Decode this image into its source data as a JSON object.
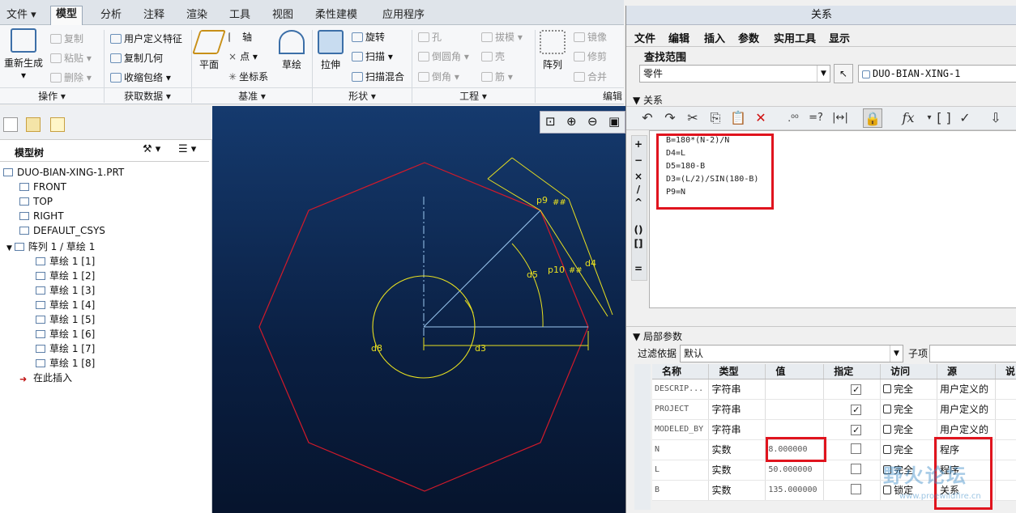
{
  "ribbon": {
    "file_tab": "文件",
    "tabs": [
      "模型",
      "分析",
      "注释",
      "渲染",
      "工具",
      "视图",
      "柔性建模",
      "应用程序"
    ],
    "regenerate": "重新生成",
    "copy": "复制",
    "paste": "粘贴",
    "delete": "删除",
    "udf": "用户定义特征",
    "copy_geom": "复制几何",
    "shrinkwrap": "收缩包络",
    "plane": "平面",
    "axis": "轴",
    "point": "点",
    "csys": "坐标系",
    "sketch": "草绘",
    "extrude": "拉伸",
    "revolve": "旋转",
    "sweep": "扫描",
    "swept_blend": "扫描混合",
    "hole": "孔",
    "round": "倒圆角",
    "chamfer": "倒角",
    "draft": "拔模",
    "shell": "壳",
    "rib": "筋",
    "pattern": "阵列",
    "mirror": "镜像",
    "trim": "修剪",
    "merge": "合并",
    "groups": [
      "操作",
      "获取数据",
      "基准",
      "形状",
      "工程",
      "编辑"
    ]
  },
  "left_panel": {
    "title": "模型树",
    "items": [
      {
        "label": "DUO-BIAN-XING-1.PRT",
        "level": 0
      },
      {
        "label": "FRONT",
        "level": 1
      },
      {
        "label": "TOP",
        "level": 1
      },
      {
        "label": "RIGHT",
        "level": 1
      },
      {
        "label": "DEFAULT_CSYS",
        "level": 1
      },
      {
        "label": "阵列 1 / 草绘 1",
        "level": 1
      },
      {
        "label": "草绘 1 [1]",
        "level": 2
      },
      {
        "label": "草绘 1 [2]",
        "level": 2
      },
      {
        "label": "草绘 1 [3]",
        "level": 2
      },
      {
        "label": "草绘 1 [4]",
        "level": 2
      },
      {
        "label": "草绘 1 [5]",
        "level": 2
      },
      {
        "label": "草绘 1 [6]",
        "level": 2
      },
      {
        "label": "草绘 1 [7]",
        "level": 2
      },
      {
        "label": "草绘 1 [8]",
        "level": 2
      },
      {
        "label": "在此插入",
        "level": 1
      }
    ]
  },
  "canvas": {
    "labels": {
      "p9": "p9",
      "p10": "p10",
      "d4": "d4",
      "d5": "d5",
      "d3": "d3",
      "d8": "d8",
      "hash": "##"
    }
  },
  "dialog": {
    "title": "关系",
    "menu": [
      "文件",
      "编辑",
      "插入",
      "参数",
      "实用工具",
      "显示"
    ],
    "scope_label": "查找范围",
    "scope_value": "零件",
    "part_value": "DUO-BIAN-XING-1",
    "relations_label": "关系",
    "relations": [
      "B=180*(N-2)/N",
      "D4=L",
      "D5=180-B",
      "D3=(L/2)/SIN(180-B)",
      "P9=N"
    ],
    "side_ops": [
      "+",
      "−",
      "×",
      "/",
      "^",
      "()",
      "[]",
      "="
    ],
    "local_params_label": "局部参数",
    "filter_label": "过滤依据",
    "filter_value": "默认",
    "sub_label": "子项",
    "columns": [
      "名称",
      "类型",
      "值",
      "指定",
      "访问",
      "源",
      "说"
    ],
    "rows": [
      {
        "name": "DESCRIP...",
        "type": "字符串",
        "value": "",
        "checked": true,
        "access": "完全",
        "source": "用户定义的"
      },
      {
        "name": "PROJECT",
        "type": "字符串",
        "value": "",
        "checked": true,
        "access": "完全",
        "source": "用户定义的"
      },
      {
        "name": "MODELED_BY",
        "type": "字符串",
        "value": "",
        "checked": true,
        "access": "完全",
        "source": "用户定义的"
      },
      {
        "name": "N",
        "type": "实数",
        "value": "8.000000",
        "checked": false,
        "access": "完全",
        "source": "程序"
      },
      {
        "name": "L",
        "type": "实数",
        "value": "50.000000",
        "checked": false,
        "access": "完全",
        "source": "程序"
      },
      {
        "name": "B",
        "type": "实数",
        "value": "135.000000",
        "checked": false,
        "access": "锁定",
        "source": "关系"
      }
    ]
  },
  "watermark": {
    "main": "野火论坛",
    "sub": "www.proewildfire.cn"
  }
}
